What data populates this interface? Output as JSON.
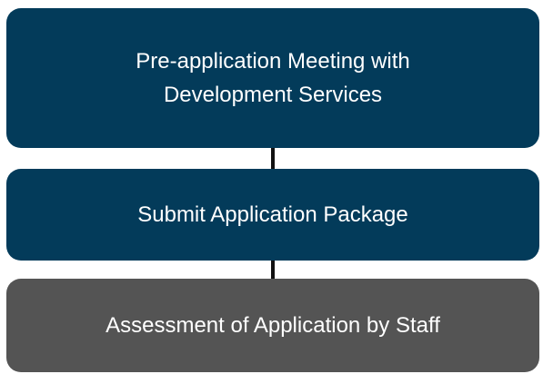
{
  "colors": {
    "primary_step": "#033b5a",
    "final_step": "#545454",
    "connector": "#111111",
    "text": "#ffffff"
  },
  "steps": [
    {
      "lines": [
        "Pre-application Meeting with",
        "Development Services"
      ],
      "color_role": "primary_step"
    },
    {
      "lines": [
        "Submit Application Package"
      ],
      "color_role": "primary_step"
    },
    {
      "lines": [
        "Assessment of Application by Staff"
      ],
      "color_role": "final_step"
    }
  ]
}
